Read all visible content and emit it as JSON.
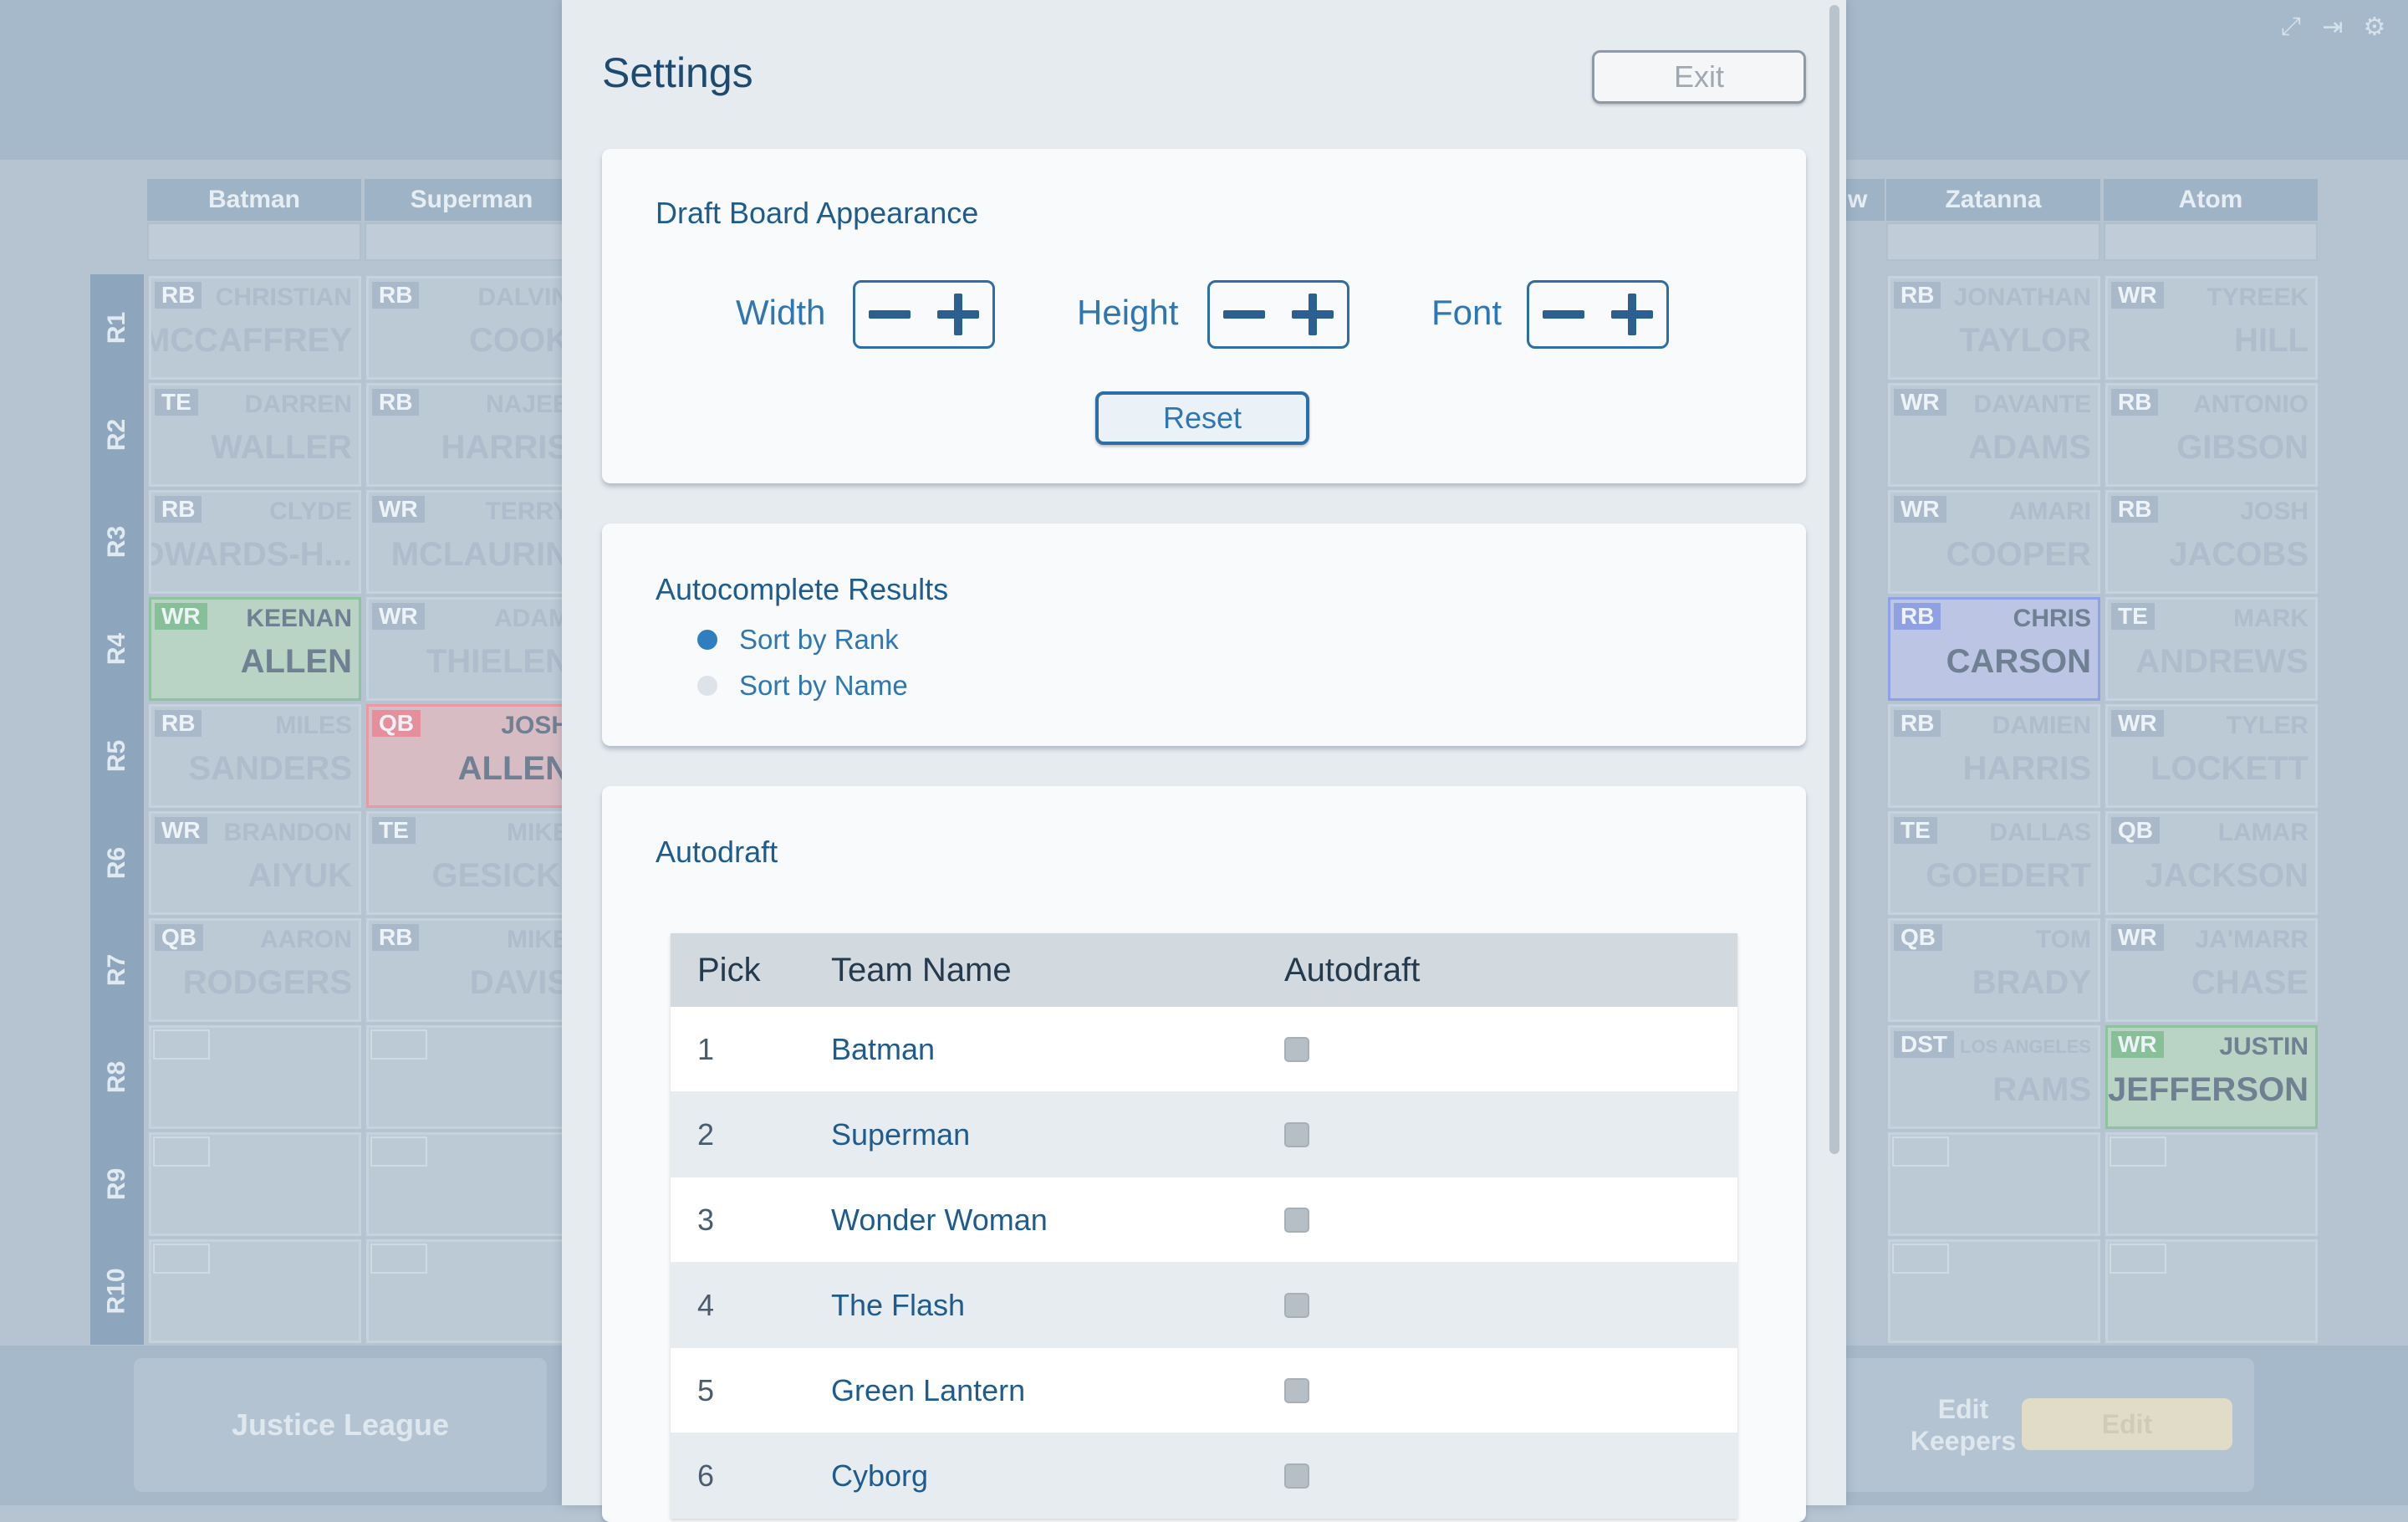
{
  "board": {
    "columns": [
      "Batman",
      "Superman",
      "Zatanna",
      "Atom"
    ],
    "partial_column": "w",
    "rounds": [
      "R1",
      "R2",
      "R3",
      "R4",
      "R5",
      "R6",
      "R7",
      "R8",
      "R9",
      "R10"
    ],
    "picks_left": [
      {
        "pos": "RB",
        "first": "CHRISTIAN",
        "last": "MCCAFFREY"
      },
      {
        "pos": "TE",
        "first": "DARREN",
        "last": "WALLER"
      },
      {
        "pos": "RB",
        "first": "CLYDE",
        "last": "EDWARDS-H..."
      },
      {
        "pos": "WR",
        "first": "KEENAN",
        "last": "ALLEN"
      },
      {
        "pos": "RB",
        "first": "MILES",
        "last": "SANDERS"
      },
      {
        "pos": "WR",
        "first": "BRANDON",
        "last": "AIYUK"
      },
      {
        "pos": "QB",
        "first": "AARON",
        "last": "RODGERS"
      }
    ],
    "picks_second": [
      {
        "pos": "RB",
        "first": "DALVIN",
        "last": "COOK"
      },
      {
        "pos": "RB",
        "first": "NAJEE",
        "last": "HARRIS"
      },
      {
        "pos": "WR",
        "first": "TERRY",
        "last": "MCLAURIN"
      },
      {
        "pos": "WR",
        "first": "ADAM",
        "last": "THIELEN"
      },
      {
        "pos": "QB",
        "first": "JOSH",
        "last": "ALLEN"
      },
      {
        "pos": "TE",
        "first": "MIKE",
        "last": "GESICKI"
      },
      {
        "pos": "RB",
        "first": "MIKE",
        "last": "DAVIS"
      }
    ],
    "picks_zatanna": [
      {
        "pos": "RB",
        "first": "JONATHAN",
        "last": "TAYLOR"
      },
      {
        "pos": "WR",
        "first": "DAVANTE",
        "last": "ADAMS"
      },
      {
        "pos": "WR",
        "first": "AMARI",
        "last": "COOPER"
      },
      {
        "pos": "RB",
        "first": "CHRIS",
        "last": "CARSON"
      },
      {
        "pos": "RB",
        "first": "DAMIEN",
        "last": "HARRIS"
      },
      {
        "pos": "TE",
        "first": "DALLAS",
        "last": "GOEDERT"
      },
      {
        "pos": "QB",
        "first": "TOM",
        "last": "BRADY"
      },
      {
        "pos": "DST",
        "first": "LOS ANGELES",
        "last": "RAMS"
      }
    ],
    "picks_atom": [
      {
        "pos": "WR",
        "first": "TYREEK",
        "last": "HILL"
      },
      {
        "pos": "RB",
        "first": "ANTONIO",
        "last": "GIBSON"
      },
      {
        "pos": "RB",
        "first": "JOSH",
        "last": "JACOBS"
      },
      {
        "pos": "TE",
        "first": "MARK",
        "last": "ANDREWS"
      },
      {
        "pos": "WR",
        "first": "TYLER",
        "last": "LOCKETT"
      },
      {
        "pos": "QB",
        "first": "LAMAR",
        "last": "JACKSON"
      },
      {
        "pos": "WR",
        "first": "JA'MARR",
        "last": "CHASE"
      },
      {
        "pos": "WR",
        "first": "JUSTIN",
        "last": "JEFFERSON"
      }
    ],
    "league_name": "Justice League",
    "edit_keepers": "Edit Keepers",
    "edit_label": "Edit"
  },
  "settings": {
    "title": "Settings",
    "exit_label": "Exit",
    "appearance": {
      "title": "Draft Board Appearance",
      "width_label": "Width",
      "height_label": "Height",
      "font_label": "Font",
      "reset_label": "Reset"
    },
    "autocomplete": {
      "title": "Autocomplete Results",
      "options": [
        {
          "label": "Sort by Rank",
          "selected": true
        },
        {
          "label": "Sort by Name",
          "selected": false
        }
      ]
    },
    "autodraft": {
      "title": "Autodraft",
      "columns": [
        "Pick",
        "Team Name",
        "Autodraft"
      ],
      "rows": [
        {
          "pick": "1",
          "team": "Batman",
          "autodraft": false
        },
        {
          "pick": "2",
          "team": "Superman",
          "autodraft": false
        },
        {
          "pick": "3",
          "team": "Wonder Woman",
          "autodraft": false
        },
        {
          "pick": "4",
          "team": "The Flash",
          "autodraft": false
        },
        {
          "pick": "5",
          "team": "Green Lantern",
          "autodraft": false
        },
        {
          "pick": "6",
          "team": "Cyborg",
          "autodraft": false
        }
      ]
    }
  },
  "colors": {
    "accent": "#2f77b2",
    "modal_bg": "#e6ebef",
    "card_bg": "#f8fafb"
  }
}
